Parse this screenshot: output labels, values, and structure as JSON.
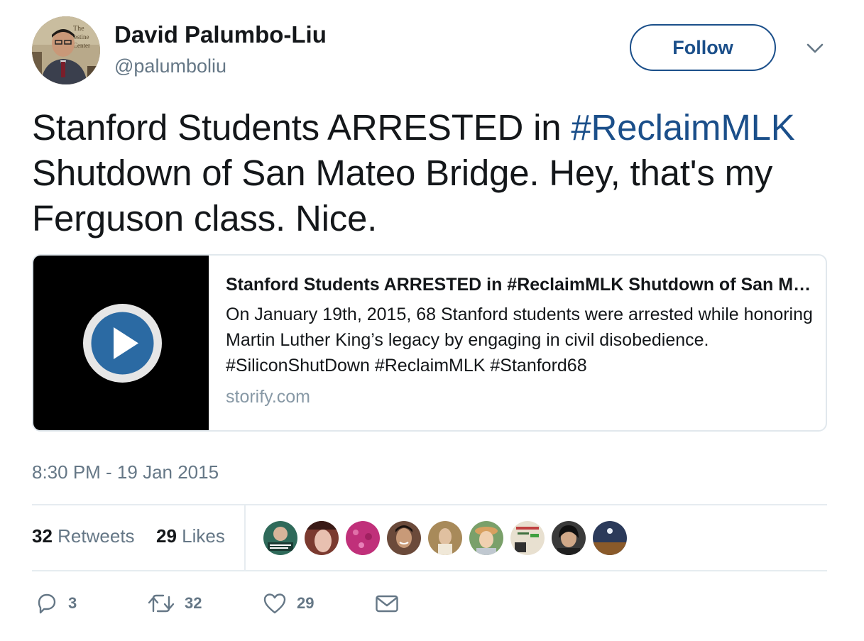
{
  "author": {
    "name": "David Palumbo-Liu",
    "handle": "@palumboliu"
  },
  "follow_button": {
    "label": "Follow"
  },
  "tweet": {
    "text_part1": "Stanford Students ARRESTED in ",
    "hashtag": "#ReclaimMLK",
    "text_part2": " Shutdown of San Mateo Bridge. Hey, that's my Ferguson class. Nice."
  },
  "card": {
    "title": "Stanford Students ARRESTED in #ReclaimMLK Shutdown of San Mateo Bridge",
    "description": "On January 19th, 2015, 68 Stanford students were arrested while honoring Martin Luther King’s legacy by engaging in civil disobedience. #SiliconShutDown #ReclaimMLK #Stanford68",
    "domain": "storify.com",
    "media_icon": "play-icon"
  },
  "timestamp": "8:30 PM - 19 Jan 2015",
  "stats": {
    "retweets_count": "32",
    "retweets_label": "Retweets",
    "likes_count": "29",
    "likes_label": "Likes"
  },
  "likers": [
    {
      "name": "liker-1",
      "color": "#2f6a5a"
    },
    {
      "name": "liker-2",
      "color": "#7b3a2f"
    },
    {
      "name": "liker-3",
      "color": "#c0307a"
    },
    {
      "name": "liker-4",
      "color": "#6b4a3a"
    },
    {
      "name": "liker-5",
      "color": "#a88a5a"
    },
    {
      "name": "liker-6",
      "color": "#7aa06a"
    },
    {
      "name": "liker-7",
      "color": "#e8e0d0"
    },
    {
      "name": "liker-8",
      "color": "#3a3a3a"
    },
    {
      "name": "liker-9",
      "color": "#2b3a5a"
    }
  ],
  "actions": {
    "reply_count": "3",
    "retweet_count": "32",
    "like_count": "29"
  },
  "colors": {
    "accent": "#1b4f8a",
    "text": "#14171a",
    "secondary": "#657786",
    "border": "#e1e8ed",
    "play_blue": "#2b6aa3"
  }
}
